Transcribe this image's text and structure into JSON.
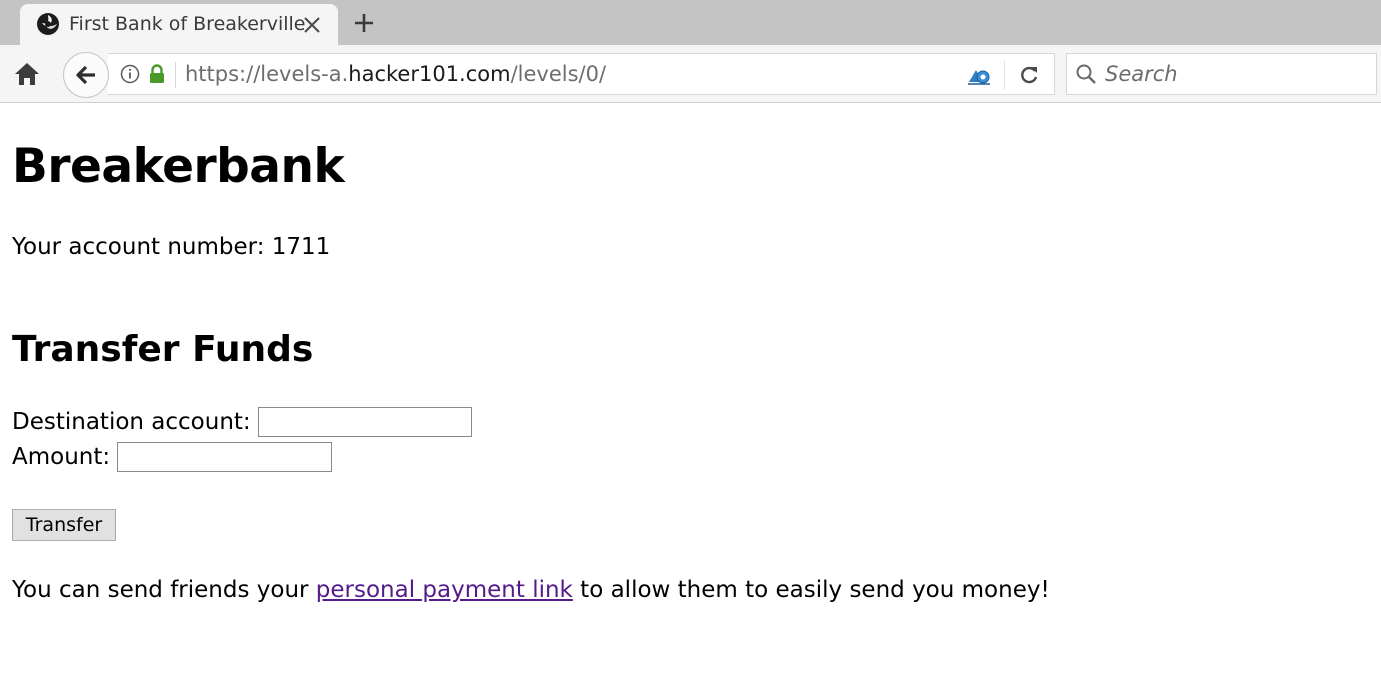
{
  "browser": {
    "tab": {
      "title": "First Bank of Breakerville",
      "favicon_icon": "globe-icon",
      "close_icon": "close-icon"
    },
    "new_tab_icon": "plus-icon",
    "nav": {
      "home_icon": "home-icon",
      "back_icon": "back-arrow-icon",
      "reload_icon": "reload-icon",
      "reader_icon": "reader-view-icon",
      "info_icon": "info-icon",
      "lock_icon": "lock-icon",
      "lock_color": "#4a9a2a"
    },
    "url": {
      "prefix": "https://levels-a.",
      "domain": "hacker101.com",
      "path": "/levels/0/"
    },
    "search": {
      "placeholder": "Search",
      "value": ""
    }
  },
  "page": {
    "title": "Breakerbank",
    "account_label": "Your account number: 1711",
    "transfer_heading": "Transfer Funds",
    "destination_label": "Destination account:",
    "destination_value": "",
    "amount_label": "Amount:",
    "amount_value": "",
    "transfer_button": "Transfer",
    "note_before": "You can send friends your ",
    "note_link": "personal payment link",
    "note_after": " to allow them to easily send you money!",
    "link_color": "#551a8b"
  }
}
